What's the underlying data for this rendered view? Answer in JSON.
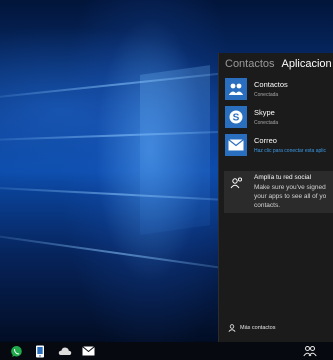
{
  "people_panel": {
    "tabs": [
      {
        "label": "Contactos",
        "active": false
      },
      {
        "label": "Aplicacion",
        "active": true
      }
    ],
    "apps": [
      {
        "name": "Contactos",
        "status": "Conectada",
        "icon": "people-icon"
      },
      {
        "name": "Skype",
        "status": "Conectada",
        "icon": "skype-icon"
      },
      {
        "name": "Correo",
        "status": "Haz clic para conectar esta aplic",
        "icon": "mail-icon"
      }
    ],
    "tooltip": {
      "title": "Amplía tu red social",
      "body": "Make sure you've signed\nyour apps to see all of yo\ncontacts."
    },
    "more_contacts": "Más contactos"
  },
  "taskbar": {
    "icons": [
      "whatsapp-icon",
      "phone-app-icon",
      "cloud-icon",
      "mail-icon",
      "people-icon"
    ]
  },
  "colors": {
    "accent": "#2a6fbf",
    "link": "#3b9be8",
    "panel_bg": "#1b1b1b"
  }
}
